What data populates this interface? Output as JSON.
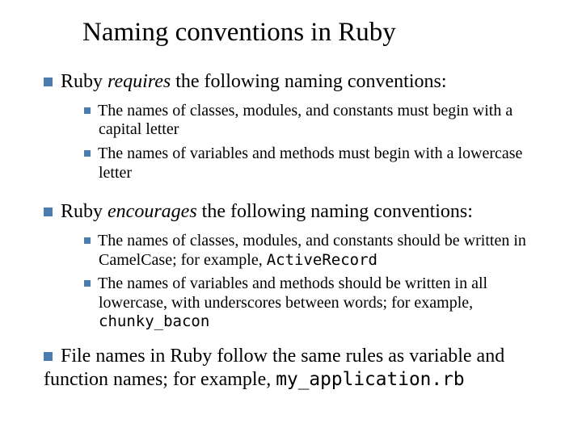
{
  "title": "Naming conventions in Ruby",
  "colors": {
    "bullet": "#4A7CB0"
  },
  "items": [
    {
      "lead": "Ruby ",
      "emph": "requires",
      "tail": " the following naming conventions:",
      "subs": [
        {
          "text": "The names of classes, modules, and constants must begin with a capital letter"
        },
        {
          "text": "The names of variables and methods must begin with a lowercase letter"
        }
      ]
    },
    {
      "lead": "Ruby ",
      "emph": "encourages",
      "tail": " the following naming conventions:",
      "subs": [
        {
          "pre": "The names of classes, modules, and constants should be written in CamelCase; for example, ",
          "code": "ActiveRecord"
        },
        {
          "pre": "The names of variables and methods should be written in all lowercase, with underscores between words; for example, ",
          "code": "chunky_bacon"
        }
      ]
    },
    {
      "pre": "File names in Ruby follow the same rules as variable and function names; for example, ",
      "code": "my_application.rb"
    }
  ]
}
